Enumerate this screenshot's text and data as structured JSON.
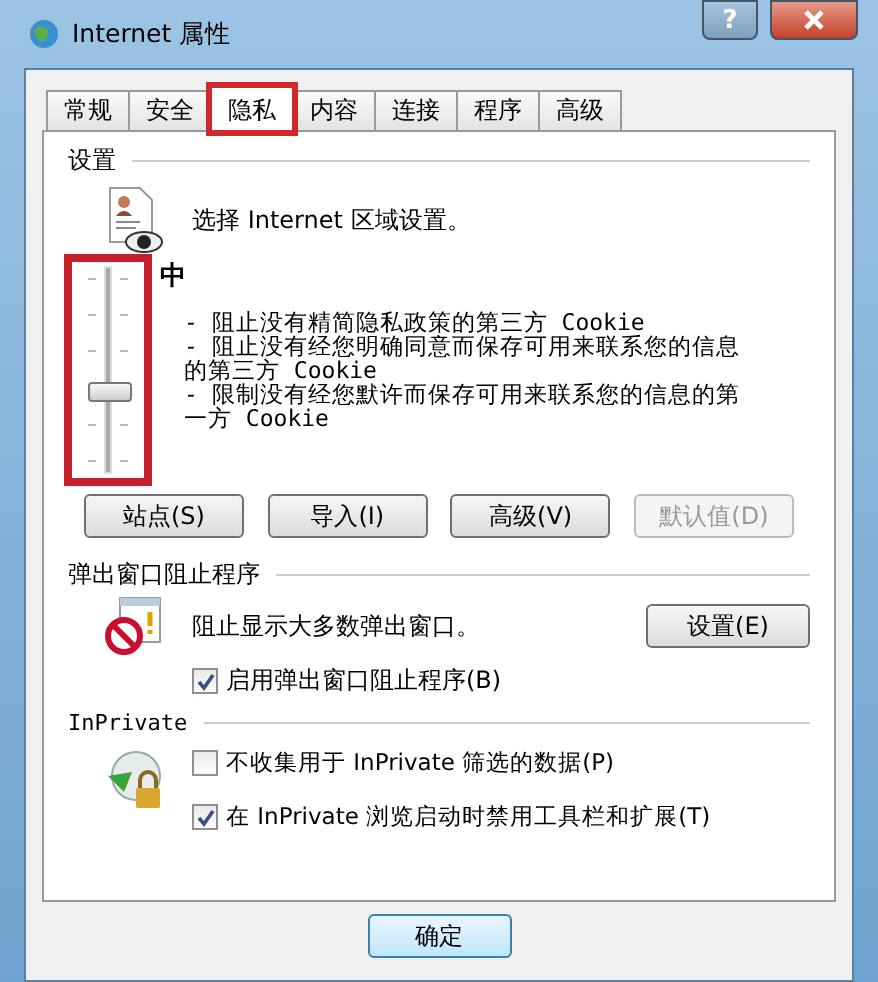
{
  "window": {
    "title": "Internet 属性",
    "help_button": "?"
  },
  "tabs": [
    {
      "label": "常规",
      "selected": false,
      "highlighted": false
    },
    {
      "label": "安全",
      "selected": false,
      "highlighted": false
    },
    {
      "label": "隐私",
      "selected": true,
      "highlighted": true
    },
    {
      "label": "内容",
      "selected": false,
      "highlighted": false
    },
    {
      "label": "连接",
      "selected": false,
      "highlighted": false
    },
    {
      "label": "程序",
      "selected": false,
      "highlighted": false
    },
    {
      "label": "高级",
      "selected": false,
      "highlighted": false
    }
  ],
  "settings": {
    "heading": "设置",
    "zone_text": "选择 Internet 区域设置。",
    "slider": {
      "level": 0.4,
      "highlighted": true
    },
    "level_name": "中",
    "description": [
      "- 阻止没有精简隐私政策的第三方 Cookie",
      "- 阻止没有经您明确同意而保存可用来联系您的信息的第三方 Cookie",
      "- 限制没有经您默许而保存可用来联系您的信息的第一方 Cookie"
    ],
    "buttons": [
      {
        "label": "站点(S)",
        "disabled": false
      },
      {
        "label": "导入(I)",
        "disabled": false
      },
      {
        "label": "高级(V)",
        "disabled": false
      },
      {
        "label": "默认值(D)",
        "disabled": true
      }
    ]
  },
  "popup_blocker": {
    "heading": "弹出窗口阻止程序",
    "text": "阻止显示大多数弹出窗口。",
    "settings_button": "设置(E)",
    "checkbox": {
      "label": "启用弹出窗口阻止程序(B)",
      "checked": true
    }
  },
  "inprivate": {
    "heading": "InPrivate",
    "checkboxes": [
      {
        "label": "不收集用于 InPrivate 筛选的数据(P)",
        "checked": false
      },
      {
        "label": "在 InPrivate 浏览启动时禁用工具栏和扩展(T)",
        "checked": true
      }
    ]
  },
  "footer": {
    "buttons": [
      "确定"
    ]
  }
}
